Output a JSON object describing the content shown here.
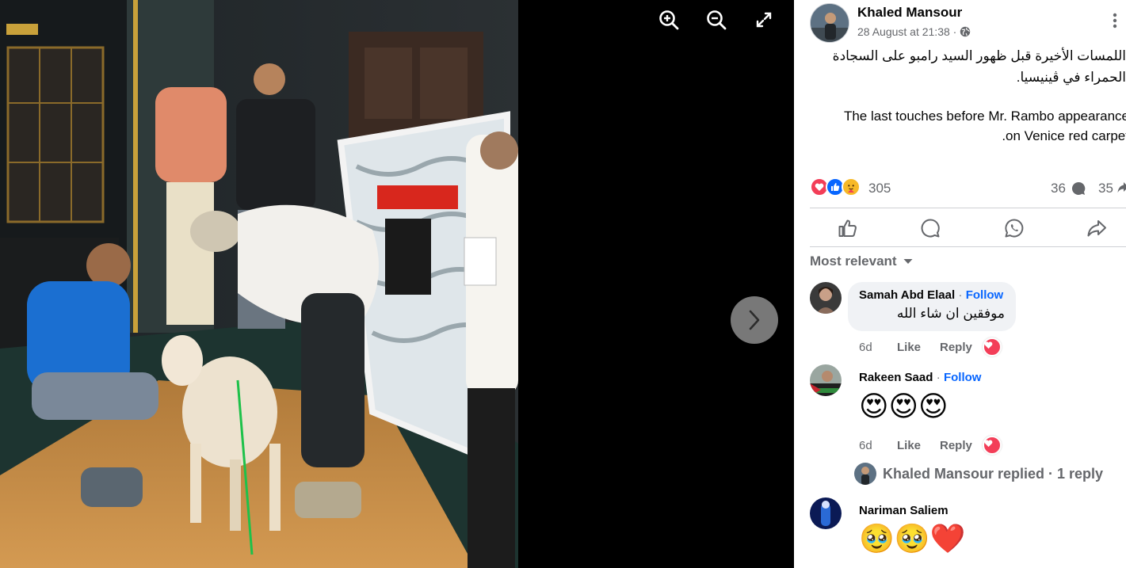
{
  "viewer": {
    "zoom_in_icon": "zoom-in-icon",
    "zoom_out_icon": "zoom-out-icon",
    "fullscreen_icon": "fullscreen-icon",
    "next_icon": "chevron-right-icon",
    "photo": "photo-of-people-grooming-a-white-dog"
  },
  "post": {
    "author": "Khaled Mansour",
    "timestamp": "28 August at 21:38 ·",
    "audience_icon": "globe-icon",
    "text_ar_line1": "اللمسات الأخيرة قبل ظهور السيد رامبو على السجادة",
    "text_ar_line2": "الحمراء في ڤينيسيا.",
    "text_en_line1": "The last touches before Mr. Rambo appearance",
    "text_en_line2": ".on Venice red carpet"
  },
  "stats": {
    "reactions": "305",
    "comments": "36",
    "shares": "35"
  },
  "colors": {
    "like_blue": "#0866ff",
    "love_red": "#f33e58",
    "care_yellow": "#f7b928",
    "muted_text": "#65676b"
  },
  "sort": {
    "label": "Most relevant"
  },
  "comments": [
    {
      "name": "Samah Abd Elaal",
      "sep": "·",
      "follow": "Follow",
      "text": "موفقين ان شاء الله",
      "time": "6d",
      "like": "Like",
      "reply": "Reply"
    },
    {
      "name": "Rakeen Saad",
      "sep": "·",
      "follow": "Follow",
      "text": "😍😍😍",
      "time": "6d",
      "like": "Like",
      "reply": "Reply"
    },
    {
      "name": "Nariman Saliem",
      "text": "🥹🥹❤️"
    }
  ],
  "replies": {
    "text": "Khaled Mansour replied · 1 reply"
  }
}
